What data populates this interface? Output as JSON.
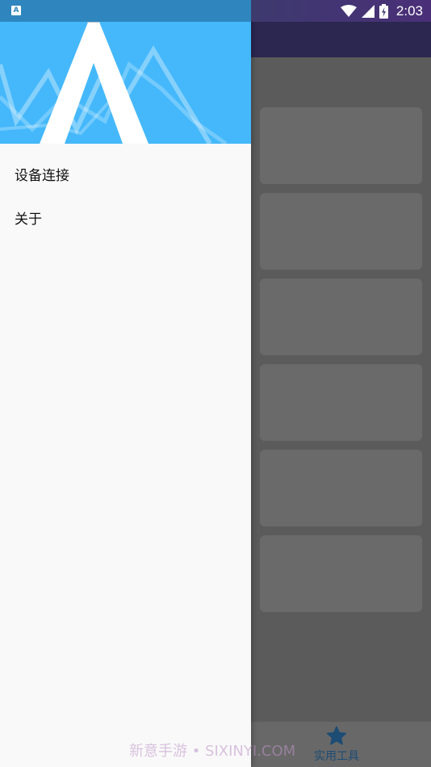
{
  "status_bar": {
    "time": "2:03",
    "app_icon_letter": "A",
    "icons": [
      "wifi-icon",
      "cell-signal-icon",
      "battery-charging-icon"
    ]
  },
  "drawer": {
    "menu_items": [
      {
        "label": "设备连接"
      },
      {
        "label": "关于"
      }
    ]
  },
  "bottom_nav": {
    "tool_label": "实用工具",
    "tool_icon": "star-icon"
  },
  "watermark": "新意手游 • SIXINYI.COM",
  "colors": {
    "header_blue": "#45b8fb",
    "drawer_bg": "#f9f9f9",
    "scrim": "#5b5b5b",
    "nav_active": "#1d4c74"
  }
}
